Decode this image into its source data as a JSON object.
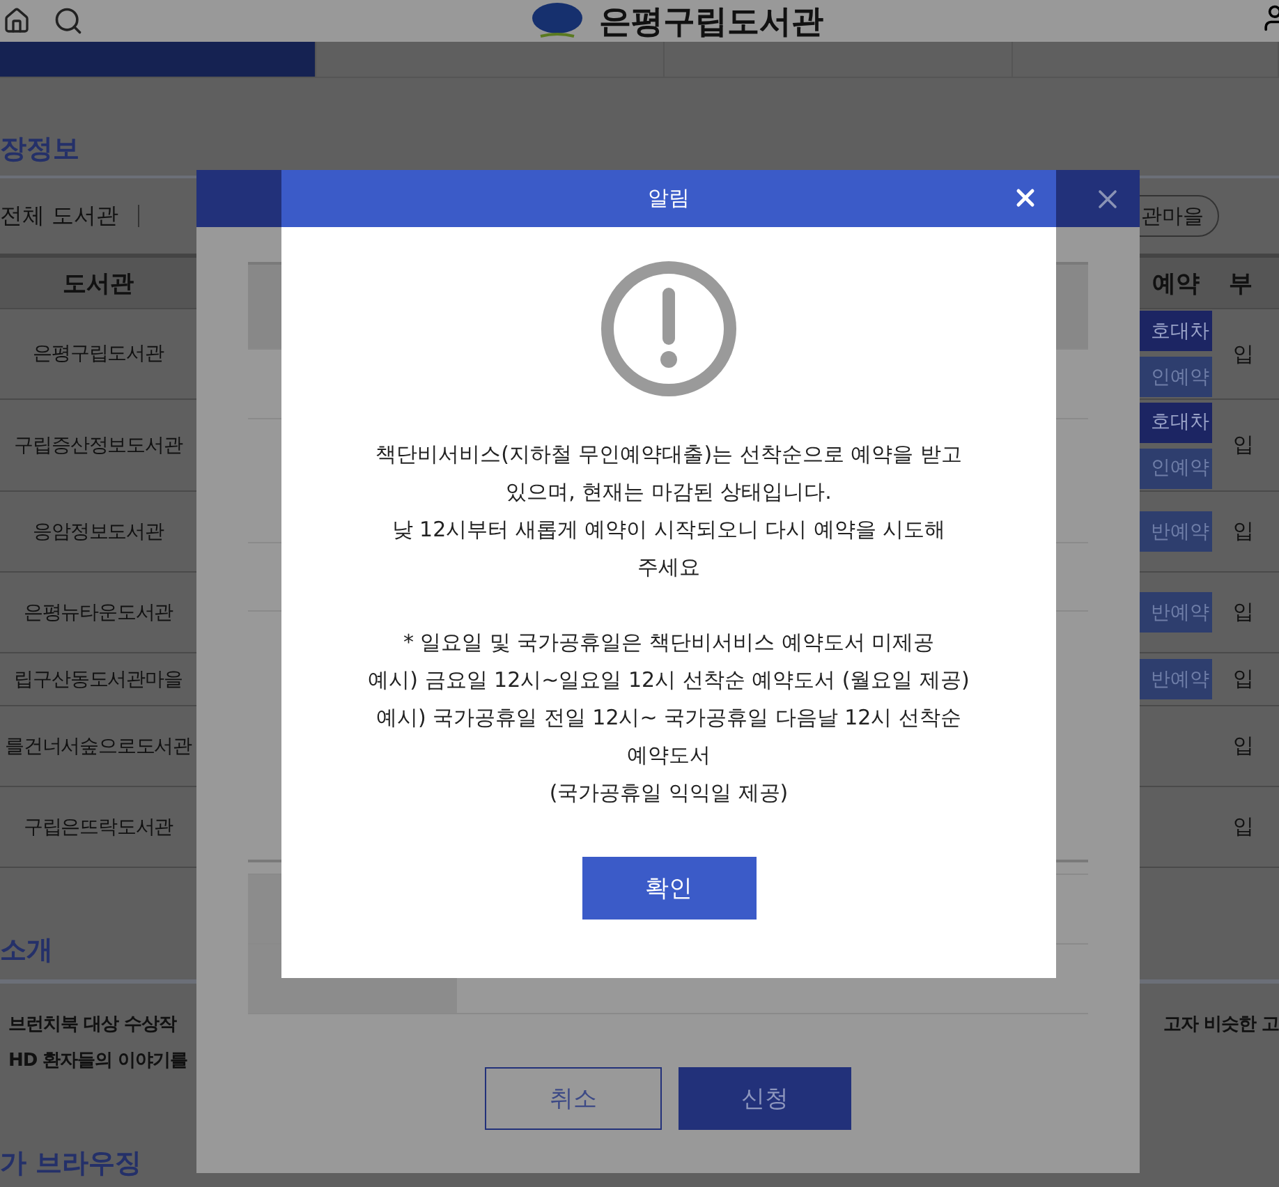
{
  "header": {
    "site_title": "은평구립도서관"
  },
  "nav_tabs": [
    {
      "selected": true
    },
    {
      "selected": false
    },
    {
      "selected": false
    },
    {
      "selected": false
    }
  ],
  "section_title": "장정보",
  "filter": {
    "label": "전체 도서관",
    "chip": "관마을"
  },
  "table": {
    "columns": [
      "도서관",
      "예약",
      "부"
    ],
    "rows": [
      {
        "library": "은평구립도서관",
        "actions": [
          {
            "label": "호대차",
            "kind": "loan"
          },
          {
            "label": "인예약",
            "kind": "reserve"
          }
        ],
        "column_3": "입"
      },
      {
        "library": "구립증산정보도서관",
        "actions": [
          {
            "label": "호대차",
            "kind": "loan"
          },
          {
            "label": "인예약",
            "kind": "reserve"
          }
        ],
        "column_3": "입"
      },
      {
        "library": "응암정보도서관",
        "actions": [
          {
            "label": "반예약",
            "kind": "reserve"
          }
        ],
        "column_3": "입"
      },
      {
        "library": "은평뉴타운도서관",
        "actions": [
          {
            "label": "반예약",
            "kind": "reserve"
          }
        ],
        "column_3": "입"
      },
      {
        "library": "립구산동도서관마을",
        "actions": [
          {
            "label": "반예약",
            "kind": "reserve"
          }
        ],
        "column_3": "입"
      },
      {
        "library": "를건너서숲으로도서관",
        "actions": [],
        "column_3": "입"
      },
      {
        "library": "구립은뜨락도서관",
        "actions": [],
        "column_3": "입"
      }
    ]
  },
  "intro": {
    "title": "소개",
    "left_lines": [
      "브런치북 대상 수상작",
      "HD 환자들의 이야기를"
    ],
    "right_line": "고자 비슷한 고",
    "next_title": "가 브라우징"
  },
  "request_dialog": {
    "buttons": [
      {
        "label": "취소",
        "kind": "secondary"
      },
      {
        "label": "신청",
        "kind": "primary"
      }
    ]
  },
  "alert": {
    "title": "알림",
    "paragraphs": [
      [
        "책단비서비스(지하철 무인예약대출)는 선착순으로 예약을 받고",
        "있으며, 현재는 마감된 상태입니다.",
        "낮 12시부터 새롭게 예약이 시작되오니 다시 예약을 시도해",
        "주세요"
      ],
      [
        "* 일요일 및 국가공휴일은 책단비서비스 예약도서 미제공",
        "예시) 금요일 12시~일요일 12시 선착순 예약도서 (월요일 제공)",
        "예시) 국가공휴일 전일 12시~ 국가공휴일 다음날 12시 선착순",
        "예약도서",
        "(국가공휴일 익익일 제공)"
      ]
    ],
    "confirm": "확인"
  }
}
